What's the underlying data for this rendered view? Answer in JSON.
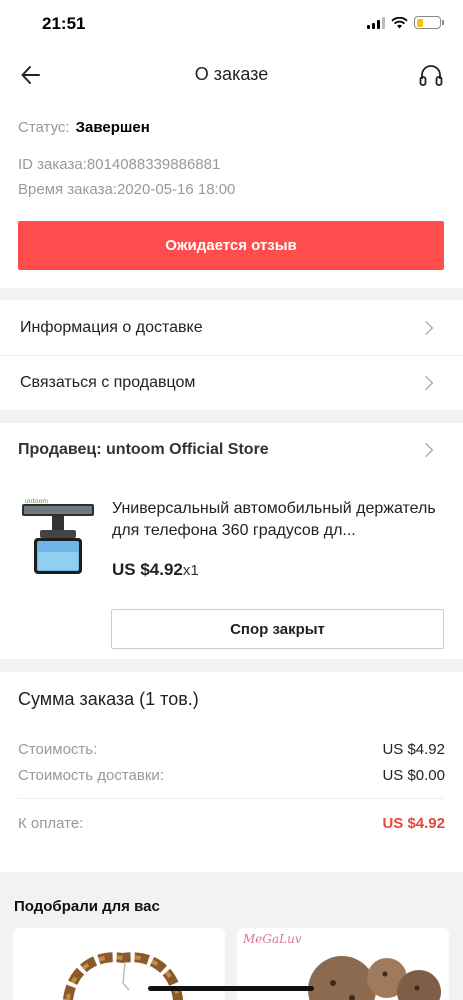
{
  "status_bar": {
    "time": "21:51"
  },
  "nav": {
    "title": "О заказе"
  },
  "order": {
    "status_label": "Статус:",
    "status_value": "Завершен",
    "id_line": "ID заказа:8014088339886881",
    "time_line": "Время заказа:2020-05-16 18:00",
    "primary_button": "Ожидается отзыв"
  },
  "menu": {
    "delivery_info": "Информация о доставке",
    "contact_seller": "Связаться с продавцом"
  },
  "seller": {
    "label": "Продавец: untoom Official Store"
  },
  "product": {
    "title": "Универсальный автомобильный держатель для телефона 360 градусов дл...",
    "price": "US $4.92",
    "qty": "x1",
    "thumb_brand": "untoom",
    "dispute_button": "Спор закрыт"
  },
  "summary": {
    "title": "Сумма заказа (1 тов.)",
    "cost_label": "Стоимость:",
    "cost_value": "US $4.92",
    "shipping_label": "Стоимость доставки:",
    "shipping_value": "US $0.00",
    "total_label": "К оплате:",
    "total_value": "US $4.92"
  },
  "recommendations": {
    "title": "Подобрали для вас",
    "card2_brand": "MeGaLuv"
  },
  "colors": {
    "accent": "#ff4c4c",
    "total_red": "#e8463a",
    "separator": "#f2f2f2"
  }
}
